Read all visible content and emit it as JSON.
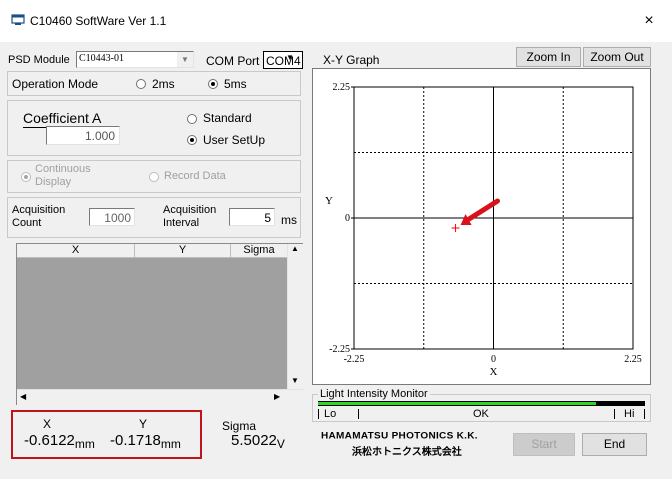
{
  "window": {
    "title": "C10460 SoftWare Ver 1.1",
    "close_glyph": "×"
  },
  "left": {
    "psd_module_label": "PSD Module",
    "psd_module_value": "C10443-01",
    "com_port_label": "COM Port",
    "com_port_value": "COM4",
    "operation_mode_label": "Operation Mode",
    "mode_2ms": "2ms",
    "mode_5ms": "5ms",
    "coefficient_label": "Coefficient A",
    "coefficient_value": "1.000",
    "standard_label": "Standard",
    "user_setup_label": "User SetUp",
    "continuous_label_1": "Continuous",
    "continuous_label_2": "Display",
    "record_data_label": "Record Data",
    "acq_count_label_1": "Acquisition",
    "acq_count_label_2": "Count",
    "acq_count_value": "1000",
    "acq_interval_label_1": "Acquisition",
    "acq_interval_label_2": "Interval",
    "acq_interval_value": "5",
    "acq_interval_unit": "ms",
    "table_headers": [
      "X",
      "Y",
      "Sigma"
    ],
    "readout": {
      "x_label": "X",
      "x_value": "-0.6122",
      "x_unit": "mm",
      "y_label": "Y",
      "y_value": "-0.1718",
      "y_unit": "mm",
      "sigma_label": "Sigma",
      "sigma_value": "5.5022",
      "sigma_unit": "V"
    }
  },
  "right": {
    "graph_label": "X-Y Graph",
    "zoom_in": "Zoom In",
    "zoom_out": "Zoom Out",
    "light_monitor_label": "Light Intensity Monitor",
    "lo": "Lo",
    "ok": "OK",
    "hi": "Hi",
    "light_level": 0.85,
    "company_1": "HAMAMATSU PHOTONICS K.K.",
    "company_2": "浜松ホトニクス株式会社",
    "start": "Start",
    "end": "End"
  },
  "chart_data": {
    "type": "scatter",
    "title": "",
    "xlabel": "X",
    "ylabel": "Y",
    "xlim": [
      -2.25,
      2.25
    ],
    "ylim": [
      -2.25,
      2.25
    ],
    "x_ticks": [
      "-2.25",
      "0",
      "2.25"
    ],
    "y_ticks": [
      "2.25",
      "0",
      "-2.25"
    ],
    "grid": "dotted",
    "points": [
      {
        "x": -0.6122,
        "y": -0.1718
      }
    ],
    "colors": {
      "point": "#ff0000",
      "arrow": "#d8121b",
      "highlight": "#c0141c",
      "level": "#2bd62b"
    }
  }
}
